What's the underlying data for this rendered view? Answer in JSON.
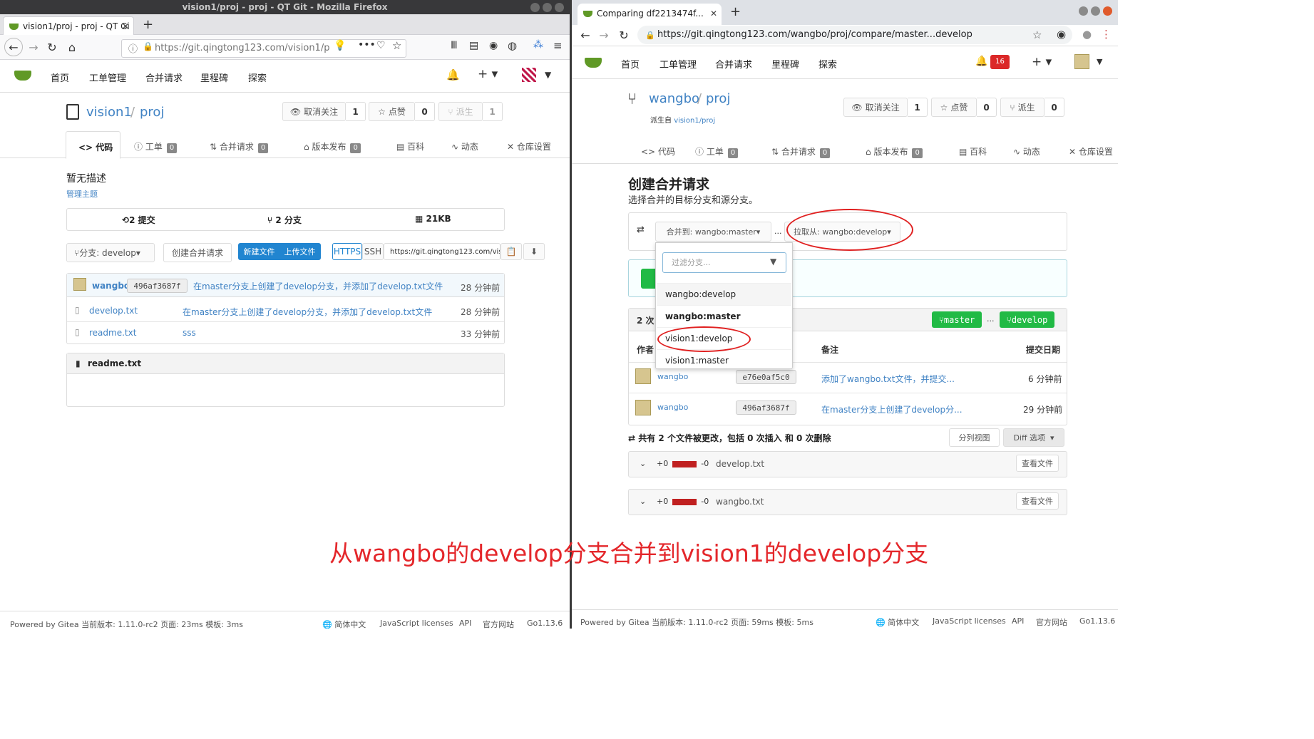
{
  "left": {
    "window_title": "vision1/proj - proj - QT Git - Mozilla Firefox",
    "tab_title": "vision1/proj - proj - QT Gi",
    "url": "https://git.qingtong123.com/vision1/p",
    "nav": [
      "首页",
      "工单管理",
      "合并请求",
      "里程碑",
      "探索"
    ],
    "repo_owner": "vision1",
    "repo_name": "proj",
    "unwatch_label": "取消关注",
    "unwatch_count": "1",
    "star_label": "点赞",
    "star_count": "0",
    "fork_label": "派生",
    "fork_count": "1",
    "tabs": [
      {
        "label": "代码",
        "badge": ""
      },
      {
        "label": "工单",
        "badge": "0"
      },
      {
        "label": "合并请求",
        "badge": "0"
      },
      {
        "label": "版本发布",
        "badge": "0"
      },
      {
        "label": "百科",
        "badge": ""
      },
      {
        "label": "动态",
        "badge": ""
      },
      {
        "label": "仓库设置",
        "badge": ""
      }
    ],
    "description": "暂无描述",
    "manage_topics": "管理主题",
    "stats": {
      "commits": "2 提交",
      "branches": "2 分支",
      "size": "21KB"
    },
    "branch_select": "分支: develop",
    "create_pr": "创建合并请求",
    "new_file": "新建文件",
    "upload_file": "上传文件",
    "https": "HTTPS",
    "ssh": "SSH",
    "clone_url": "https://git.qingtong123.com/visio",
    "last_commit": {
      "author": "wangbo",
      "sha": "496af3687f",
      "message": "在master分支上创建了develop分支，并添加了develop.txt文件",
      "time": "28 分钟前"
    },
    "files": [
      {
        "name": "develop.txt",
        "message": "在master分支上创建了develop分支，并添加了develop.txt文件",
        "time": "28 分钟前"
      },
      {
        "name": "readme.txt",
        "message": "sss",
        "time": "33 分钟前"
      }
    ],
    "readme_title": "readme.txt",
    "footer": {
      "powered": "Powered by Gitea 当前版本: 1.11.0-rc2 页面: 23ms 模板: 3ms",
      "lang": "简体中文",
      "js": "JavaScript licenses",
      "api": "API",
      "site": "官方网站",
      "go": "Go1.13.6"
    }
  },
  "right": {
    "tab_title": "Comparing df2213474f...",
    "url": "https://git.qingtong123.com/wangbo/proj/compare/master...develop",
    "nav": [
      "首页",
      "工单管理",
      "合并请求",
      "里程碑",
      "探索"
    ],
    "notif_count": "16",
    "repo_owner": "wangbo",
    "repo_name": "proj",
    "forked_from_prefix": "派生自",
    "forked_from": "vision1/proj",
    "unwatch_label": "取消关注",
    "unwatch_count": "1",
    "star_label": "点赞",
    "star_count": "0",
    "fork_label": "派生",
    "fork_count": "0",
    "tabs": [
      {
        "label": "代码",
        "badge": ""
      },
      {
        "label": "工单",
        "badge": "0"
      },
      {
        "label": "合并请求",
        "badge": "0"
      },
      {
        "label": "版本发布",
        "badge": "0"
      },
      {
        "label": "百科",
        "badge": ""
      },
      {
        "label": "动态",
        "badge": ""
      },
      {
        "label": "仓库设置",
        "badge": ""
      }
    ],
    "heading": "创建合并请求",
    "subheading": "选择合并的目标分支和源分支。",
    "merge_into": "合并到: wangbo:master",
    "dots": "...",
    "pull_from": "拉取从: wangbo:develop",
    "filter_placeholder": "过滤分支...",
    "dropdown_items": [
      "wangbo:develop",
      "wangbo:master",
      "vision1:develop",
      "vision1:master"
    ],
    "commits_title": "2 次",
    "branch_master": "master",
    "branch_develop": "develop",
    "col_author": "作者",
    "col_message": "备注",
    "col_date": "提交日期",
    "commits": [
      {
        "author": "wangbo",
        "sha": "e76e0af5c0",
        "message": "添加了wangbo.txt文件，并提交...",
        "time": "6 分钟前"
      },
      {
        "author": "wangbo",
        "sha": "496af3687f",
        "message": "在master分支上创建了develop分...",
        "time": "29 分钟前"
      }
    ],
    "diff_summary": "共有 2 个文件被更改，包括 0 次插入 和 0 次删除",
    "split_view": "分列视图",
    "diff_options": "Diff 选项",
    "diff_files": [
      {
        "plus": "+0",
        "minus": "-0",
        "name": "develop.txt",
        "view": "查看文件"
      },
      {
        "plus": "+0",
        "minus": "-0",
        "name": "wangbo.txt",
        "view": "查看文件"
      }
    ],
    "footer": {
      "powered": "Powered by Gitea 当前版本: 1.11.0-rc2 页面: 59ms 模板: 5ms",
      "lang": "简体中文",
      "js": "JavaScript licenses",
      "api": "API",
      "site": "官方网站",
      "go": "Go1.13.6"
    }
  },
  "annotation_caption": "从wangbo的develop分支合并到vision1的develop分支",
  "colors": {
    "gitea_green": "#609926",
    "link_blue": "#4183c4",
    "button_blue": "#2185d0",
    "annotation_red": "#e4272b",
    "badge_red": "#db2828"
  }
}
